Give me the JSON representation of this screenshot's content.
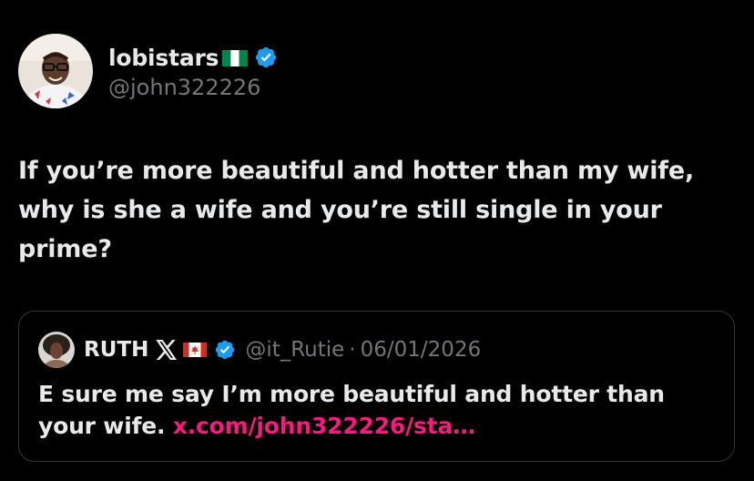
{
  "author": {
    "display_name": "lobistars",
    "flag_icon": "nigeria-flag-icon",
    "verified_icon": "verified-badge-icon",
    "handle": "@john322226",
    "avatar": "profile-photo-man-glasses"
  },
  "tweet": {
    "text": "If you’re more beautiful and hotter than my wife,\nwhy is she a wife and you’re still single in your\nprime?"
  },
  "quoted_tweet": {
    "display_name": "RUTH",
    "x_icon": "x-logo-icon",
    "flag_icon": "canada-flag-icon",
    "verified_icon": "verified-badge-icon",
    "handle": "@it_Rutie",
    "separator": "·",
    "date": "06/01/2026",
    "text": "E sure me say I’m more beautiful and hotter than your wife.",
    "link": "x.com/john322226/sta…"
  },
  "colors": {
    "background": "#000000",
    "text_primary": "#e7e9ea",
    "text_secondary": "#71767b",
    "verified_blue": "#1d9bf0",
    "link_pink": "#f91880",
    "border": "#333639"
  }
}
